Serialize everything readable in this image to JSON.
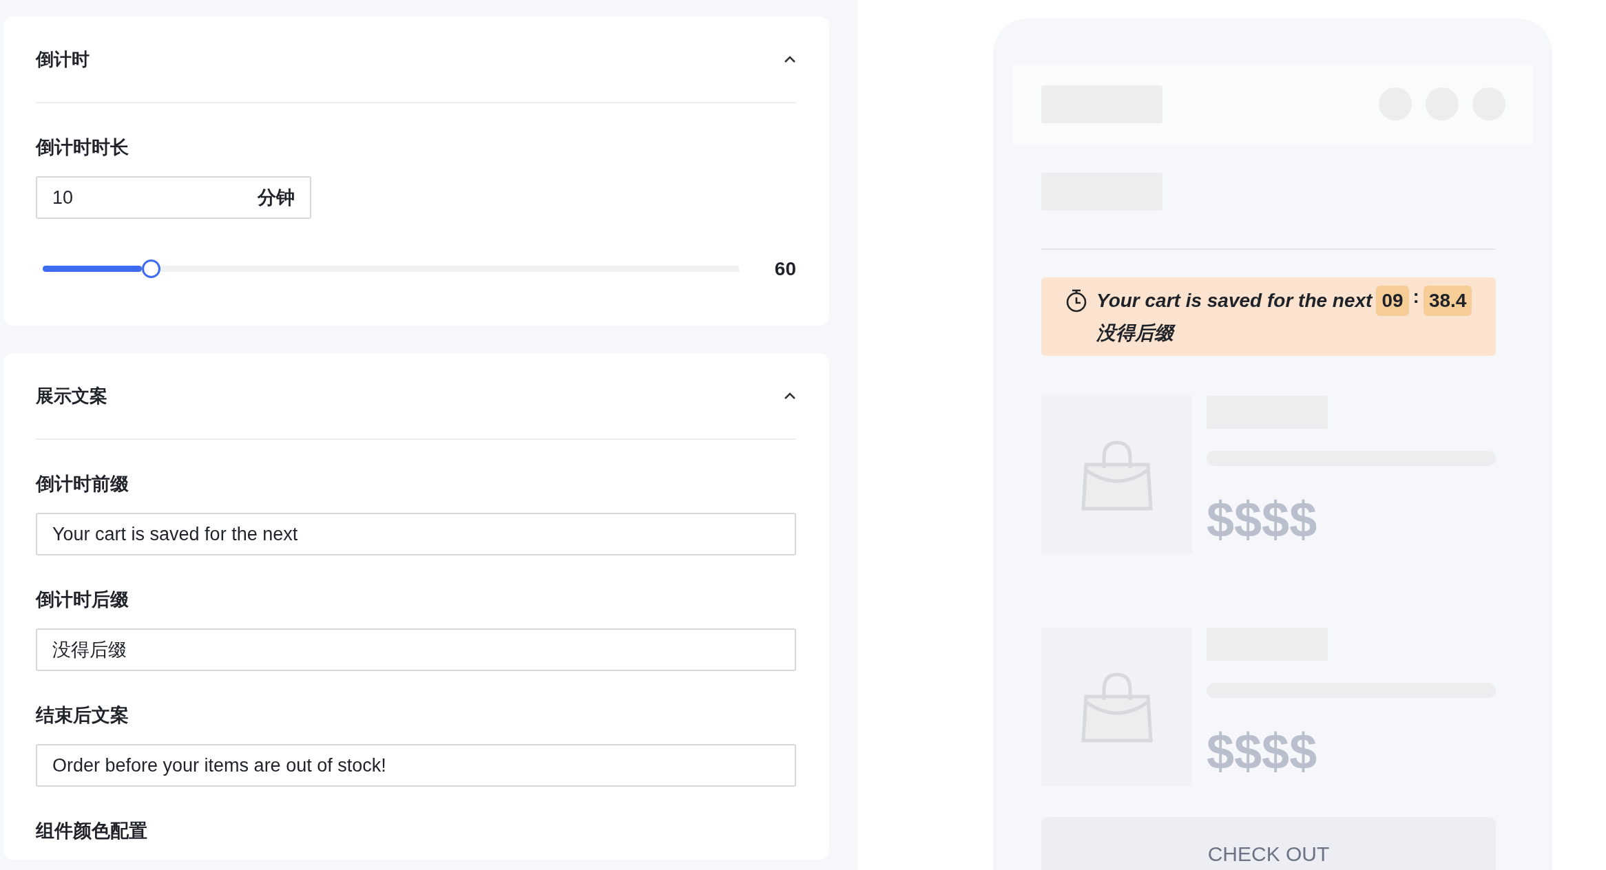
{
  "settings": [
    {
      "title": "倒计时",
      "expanded": true,
      "fields": [
        {
          "kind": "duration",
          "label": "倒计时时长",
          "value": "10",
          "unit": "分钟",
          "level": 0.155,
          "max": "60"
        }
      ]
    },
    {
      "title": "展示文案",
      "expanded": true,
      "fields": [
        {
          "kind": "text",
          "label": "倒计时前缀",
          "value": "Your cart is saved for the next"
        },
        {
          "kind": "text",
          "label": "倒计时后缀",
          "value": "没得后缀"
        },
        {
          "kind": "text",
          "label": "结束后文案",
          "value": "Order before your items are out of stock!"
        },
        {
          "kind": "heading",
          "label": "组件颜色配置"
        }
      ]
    }
  ],
  "preview": {
    "banner": {
      "prefix": "Your cart is saved for the next",
      "minutes": "09",
      "separator": ":",
      "seconds": "38.4",
      "suffix": "没得后缀"
    },
    "products": [
      {
        "price": "$$$$"
      },
      {
        "price": "$$$$"
      }
    ],
    "checkout": "CHECK OUT"
  }
}
